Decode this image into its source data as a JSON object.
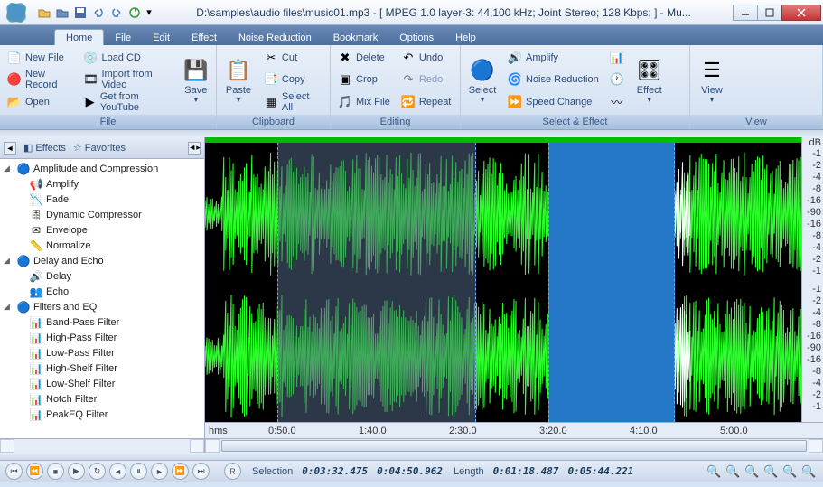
{
  "title": "D:\\samples\\audio files\\music01.mp3 - [ MPEG 1.0 layer-3: 44,100 kHz; Joint Stereo; 128 Kbps;  ] - Mu...",
  "menubar": [
    "Home",
    "File",
    "Edit",
    "Effect",
    "Noise Reduction",
    "Bookmark",
    "Options",
    "Help"
  ],
  "ribbon": {
    "file": {
      "label": "File",
      "new_file": "New File",
      "new_record": "New Record",
      "open": "Open",
      "load_cd": "Load CD",
      "import_video": "Import from Video",
      "get_youtube": "Get from YouTube",
      "save": "Save"
    },
    "clipboard": {
      "label": "Clipboard",
      "paste": "Paste",
      "cut": "Cut",
      "copy": "Copy",
      "select_all": "Select All"
    },
    "editing": {
      "label": "Editing",
      "delete": "Delete",
      "crop": "Crop",
      "mix": "Mix File",
      "undo": "Undo",
      "redo": "Redo",
      "repeat": "Repeat"
    },
    "select_effect": {
      "label": "Select & Effect",
      "select": "Select",
      "amplify": "Amplify",
      "noise_reduction": "Noise Reduction",
      "speed_change": "Speed Change",
      "effect": "Effect"
    },
    "view": {
      "label": "View",
      "view": "View"
    }
  },
  "sidebar": {
    "tabs": {
      "effects": "Effects",
      "favorites": "Favorites"
    },
    "tree": [
      {
        "label": "Amplitude and Compression",
        "type": "group"
      },
      {
        "label": "Amplify",
        "type": "child"
      },
      {
        "label": "Fade",
        "type": "child"
      },
      {
        "label": "Dynamic Compressor",
        "type": "child"
      },
      {
        "label": "Envelope",
        "type": "child"
      },
      {
        "label": "Normalize",
        "type": "child"
      },
      {
        "label": "Delay and Echo",
        "type": "group"
      },
      {
        "label": "Delay",
        "type": "child"
      },
      {
        "label": "Echo",
        "type": "child"
      },
      {
        "label": "Filters and EQ",
        "type": "group"
      },
      {
        "label": "Band-Pass Filter",
        "type": "child"
      },
      {
        "label": "High-Pass Filter",
        "type": "child"
      },
      {
        "label": "Low-Pass Filter",
        "type": "child"
      },
      {
        "label": "High-Shelf Filter",
        "type": "child"
      },
      {
        "label": "Low-Shelf Filter",
        "type": "child"
      },
      {
        "label": "Notch Filter",
        "type": "child"
      },
      {
        "label": "PeakEQ Filter",
        "type": "child"
      }
    ]
  },
  "time_ruler": {
    "unit": "hms",
    "ticks": [
      "0:50.0",
      "1:40.0",
      "2:30.0",
      "3:20.0",
      "4:10.0",
      "5:00.0"
    ]
  },
  "db_ruler": {
    "unit": "dB",
    "ticks": [
      "-1",
      "-2",
      "-4",
      "-8",
      "-16",
      "-90",
      "-16",
      "-8",
      "-4",
      "-2",
      "-1"
    ]
  },
  "status": {
    "selection_label": "Selection",
    "selection_start": "0:03:32.475",
    "selection_end": "0:04:50.962",
    "length_label": "Length",
    "length_val": "0:01:18.487",
    "total": "0:05:44.221"
  }
}
